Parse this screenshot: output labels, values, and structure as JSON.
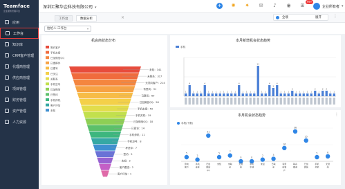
{
  "app": {
    "logo": "Teamface",
    "logo_sub": "企业服务管理平台"
  },
  "sidebar": {
    "items": [
      {
        "label": "应用",
        "active": false
      },
      {
        "label": "工作台",
        "active": true
      },
      {
        "label": "知识库",
        "active": false
      },
      {
        "label": "CRM客户管理",
        "active": false
      },
      {
        "label": "代理商管理",
        "active": false
      },
      {
        "label": "供应商管理",
        "active": false
      },
      {
        "label": "项目管理",
        "active": false
      },
      {
        "label": "财务管理",
        "active": false
      },
      {
        "label": "资产管理",
        "active": false
      },
      {
        "label": "人力资源",
        "active": false
      }
    ]
  },
  "topbar": {
    "company": "深圳汇聚华企科技有限公司",
    "icons": [
      "plus-icon",
      "sun-icon",
      "sun-icon",
      "mail-icon",
      "bell-icon",
      "eye-icon",
      "grid-icon"
    ],
    "badge": "99+",
    "user": "企业所有者"
  },
  "tabs": [
    {
      "label": "工作台",
      "active": false
    },
    {
      "label": "数据分析",
      "active": true
    }
  ],
  "modules": {
    "current": "全境",
    "expand": "展开"
  },
  "filter": {
    "label": "拍给人:工作台"
  },
  "colors": {
    "accent": "#2f86e6",
    "sidebar": "#243348",
    "danger": "#e03c3c",
    "bar": "#4a7fd6"
  },
  "funnel": {
    "title": "机会商状态分布",
    "legend": [
      "签约客户",
      "手机未接",
      "已加微信QQ",
      "已建群件",
      "已建号",
      "已关注",
      "关联系",
      "手机空号",
      "已加微信",
      "已签约",
      "手机停机",
      "客户评估",
      "未知"
    ],
    "segments": [
      {
        "label": "未知",
        "value": 341
      },
      {
        "label": "未联系",
        "value": 317
      },
      {
        "label": "无意向客户",
        "value": 214
      },
      {
        "label": "有意向",
        "value": 91
      },
      {
        "label": "已联系",
        "value": 69
      },
      {
        "label": "已加微信QQ",
        "value": 58
      },
      {
        "label": "手机未接",
        "value": 50
      },
      {
        "label": "手机关机",
        "value": 19
      },
      {
        "label": "已加微信QQ",
        "value": 18
      },
      {
        "label": "已面谈",
        "value": 14
      },
      {
        "label": "手机停机",
        "value": 11
      },
      {
        "label": "手机空号",
        "value": 8
      },
      {
        "label": "考虑中",
        "value": 7
      },
      {
        "label": "签约",
        "value": 5
      },
      {
        "label": "未知",
        "value": 3
      },
      {
        "label": "客户跟进",
        "value": 2
      },
      {
        "label": "客户评估",
        "value": 1
      }
    ],
    "colors": [
      "#e74c3c",
      "#f06b3d",
      "#f4863f",
      "#f7a244",
      "#f7bc47",
      "#f4d049",
      "#e2dd4b",
      "#c2e04d",
      "#8ecf55",
      "#5cc06a",
      "#3db67e",
      "#36a8a4",
      "#3f8fd0",
      "#6a72d6",
      "#9862d1",
      "#c45fc6",
      "#e06aa8"
    ]
  },
  "chart_data": [
    {
      "type": "bar",
      "title": "本月新增机会状态趋势",
      "series": [
        {
          "name": "手机",
          "values": [
            1,
            4,
            1,
            1,
            1,
            4,
            1,
            1,
            1,
            1,
            1,
            1,
            1,
            1,
            4,
            1,
            1,
            1,
            1,
            11,
            1,
            1,
            4,
            3,
            4,
            1,
            1,
            1,
            2,
            1,
            1,
            1,
            1,
            1,
            2,
            1,
            2,
            2,
            1,
            1
          ]
        }
      ],
      "ylabel": "",
      "ylim": [
        0,
        14
      ]
    },
    {
      "type": "scatter",
      "title": "本月机会状态趋势",
      "legend": "手机(个数)",
      "categories": [
        "意向客户",
        "手机未接",
        "已加微信QQ",
        "未知",
        "未联系",
        "无意向",
        "手机不通",
        "未接",
        "已联系",
        "有意向客户",
        "联系跟进",
        "已加微信",
        "手机关机",
        "无意向"
      ],
      "series": [
        {
          "name": "手机(个数)",
          "values": [
            5,
            2,
            31,
            5,
            7,
            0,
            0,
            2,
            3,
            16,
            36,
            25,
            5,
            6
          ]
        }
      ],
      "ylim": [
        0,
        40
      ]
    }
  ]
}
